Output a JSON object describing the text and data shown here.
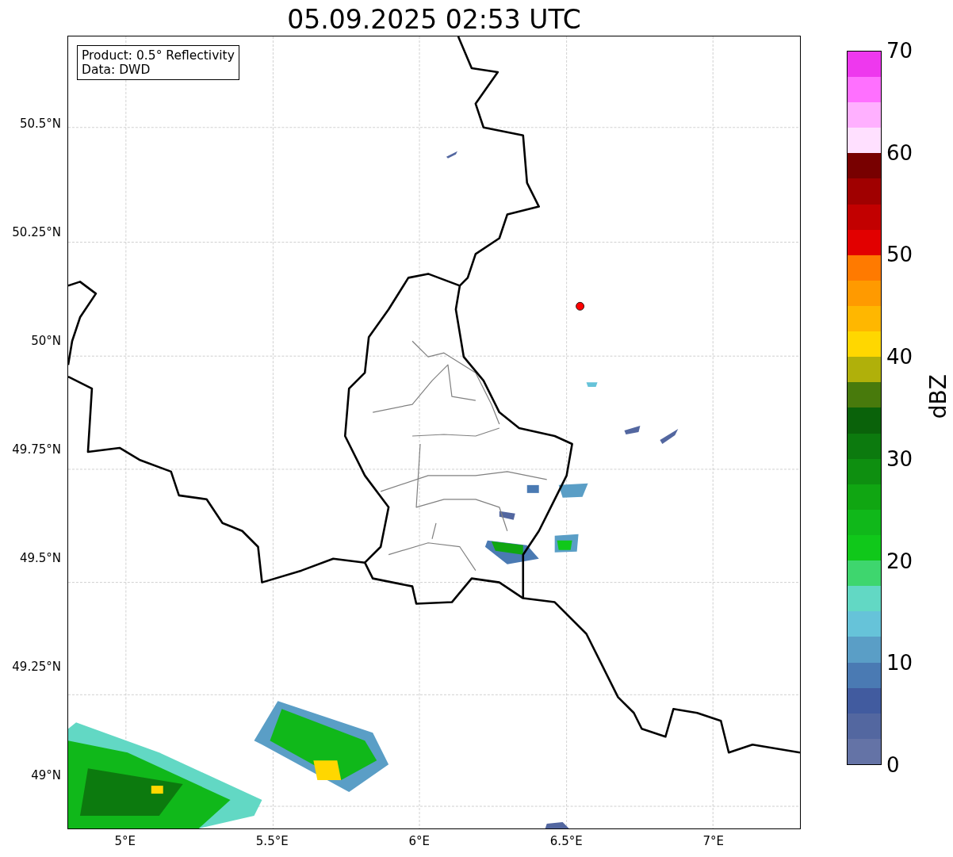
{
  "title": "05.09.2025 02:53 UTC",
  "info_box": [
    "Product: 0.5° Reflectivity",
    "Data: DWD"
  ],
  "map": {
    "kind": "map-picture"
  },
  "y_ticks": [
    "50.5°N",
    "50.25°N",
    "50°N",
    "49.75°N",
    "49.5°N",
    "49.25°N",
    "49°N"
  ],
  "x_ticks": [
    "5°E",
    "5.5°E",
    "6°E",
    "6.5°E",
    "7°E"
  ],
  "colorbar": {
    "label": "dBZ",
    "ticks": [
      "70",
      "60",
      "50",
      "40",
      "30",
      "20",
      "10",
      "0"
    ],
    "segments": [
      {
        "color": "#6473a6"
      },
      {
        "color": "#5367a0"
      },
      {
        "color": "#415b9f"
      },
      {
        "color": "#4a7ab3"
      },
      {
        "color": "#5a9ec6"
      },
      {
        "color": "#66c3d9"
      },
      {
        "color": "#62d8c4"
      },
      {
        "color": "#3ed66e"
      },
      {
        "color": "#10c81a"
      },
      {
        "color": "#10b81a"
      },
      {
        "color": "#10a612"
      },
      {
        "color": "#0e8f10"
      },
      {
        "color": "#0c7a0e"
      },
      {
        "color": "#0a620a"
      },
      {
        "color": "#487a0c"
      },
      {
        "color": "#b0b00a"
      },
      {
        "color": "#ffd700"
      },
      {
        "color": "#ffb700"
      },
      {
        "color": "#ff9a00"
      },
      {
        "color": "#ff7a00"
      },
      {
        "color": "#e20000"
      },
      {
        "color": "#c20000"
      },
      {
        "color": "#a00000"
      },
      {
        "color": "#780000"
      },
      {
        "color": "#ffe0ff"
      },
      {
        "color": "#ffb0ff"
      },
      {
        "color": "#ff70ff"
      },
      {
        "color": "#ee38ee"
      }
    ]
  }
}
